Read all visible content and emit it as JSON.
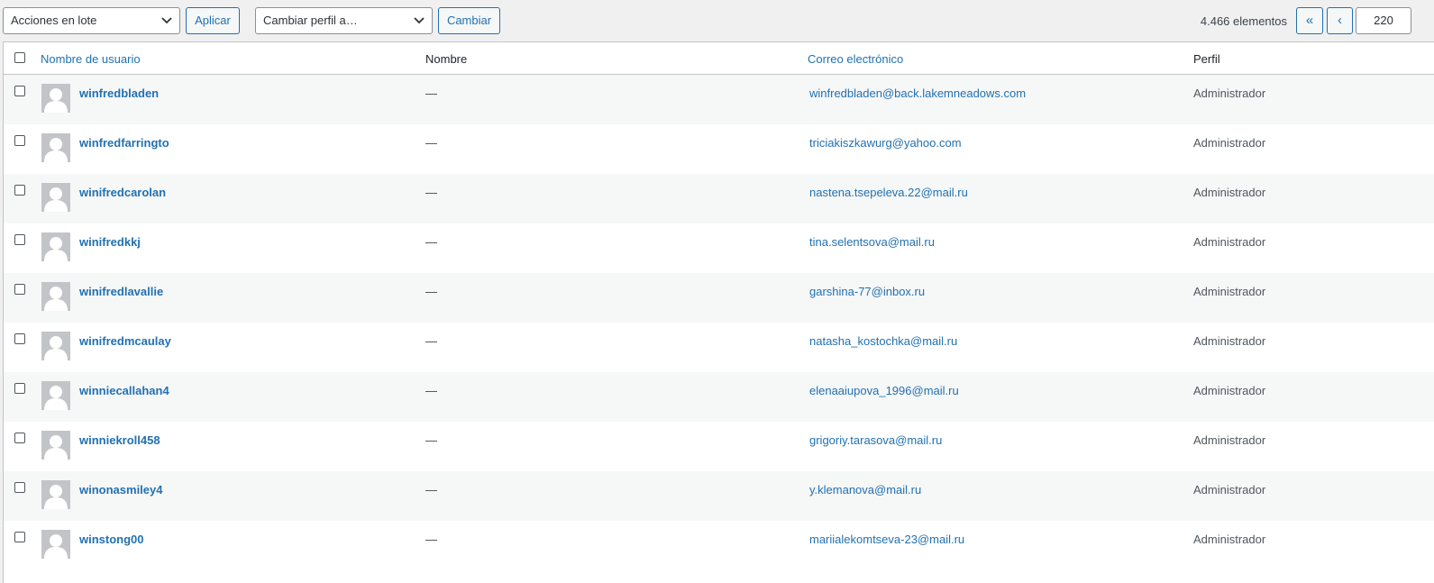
{
  "toolbar": {
    "bulk_actions": "Acciones en lote",
    "apply_label": "Aplicar",
    "change_role": "Cambiar perfil a…",
    "change_label": "Cambiar",
    "items_count": "4.466 elementos",
    "first_page": "«",
    "prev_page": "‹",
    "current_page": "220"
  },
  "table": {
    "columns": {
      "username": "Nombre de usuario",
      "name": "Nombre",
      "email": "Correo electrónico",
      "role": "Perfil"
    },
    "rows": [
      {
        "username": "winfredbladen",
        "name": "—",
        "email": "winfredbladen@back.lakemneadows.com",
        "role": "Administrador"
      },
      {
        "username": "winfredfarringto",
        "name": "—",
        "email": "triciakiszkawurg@yahoo.com",
        "role": "Administrador"
      },
      {
        "username": "winifredcarolan",
        "name": "—",
        "email": "nastena.tsepeleva.22@mail.ru",
        "role": "Administrador"
      },
      {
        "username": "winifredkkj",
        "name": "—",
        "email": "tina.selentsova@mail.ru",
        "role": "Administrador"
      },
      {
        "username": "winifredlavallie",
        "name": "—",
        "email": "garshina-77@inbox.ru",
        "role": "Administrador"
      },
      {
        "username": "winifredmcaulay",
        "name": "—",
        "email": "natasha_kostochka@mail.ru",
        "role": "Administrador"
      },
      {
        "username": "winniecallahan4",
        "name": "—",
        "email": "elenaaiupova_1996@mail.ru",
        "role": "Administrador"
      },
      {
        "username": "winniekroll458",
        "name": "—",
        "email": "grigoriy.tarasova@mail.ru",
        "role": "Administrador"
      },
      {
        "username": "winonasmiley4",
        "name": "—",
        "email": "y.klemanova@mail.ru",
        "role": "Administrador"
      },
      {
        "username": "winstong00",
        "name": "—",
        "email": "mariialekomtseva-23@mail.ru",
        "role": "Administrador"
      }
    ]
  },
  "colors": {
    "accent": "#2271b1",
    "background": "#f0f0f1",
    "row_alt": "#f6f7f7"
  },
  "icons": {
    "dropdown": "chevron-down-icon",
    "avatar": "default-avatar-icon"
  }
}
